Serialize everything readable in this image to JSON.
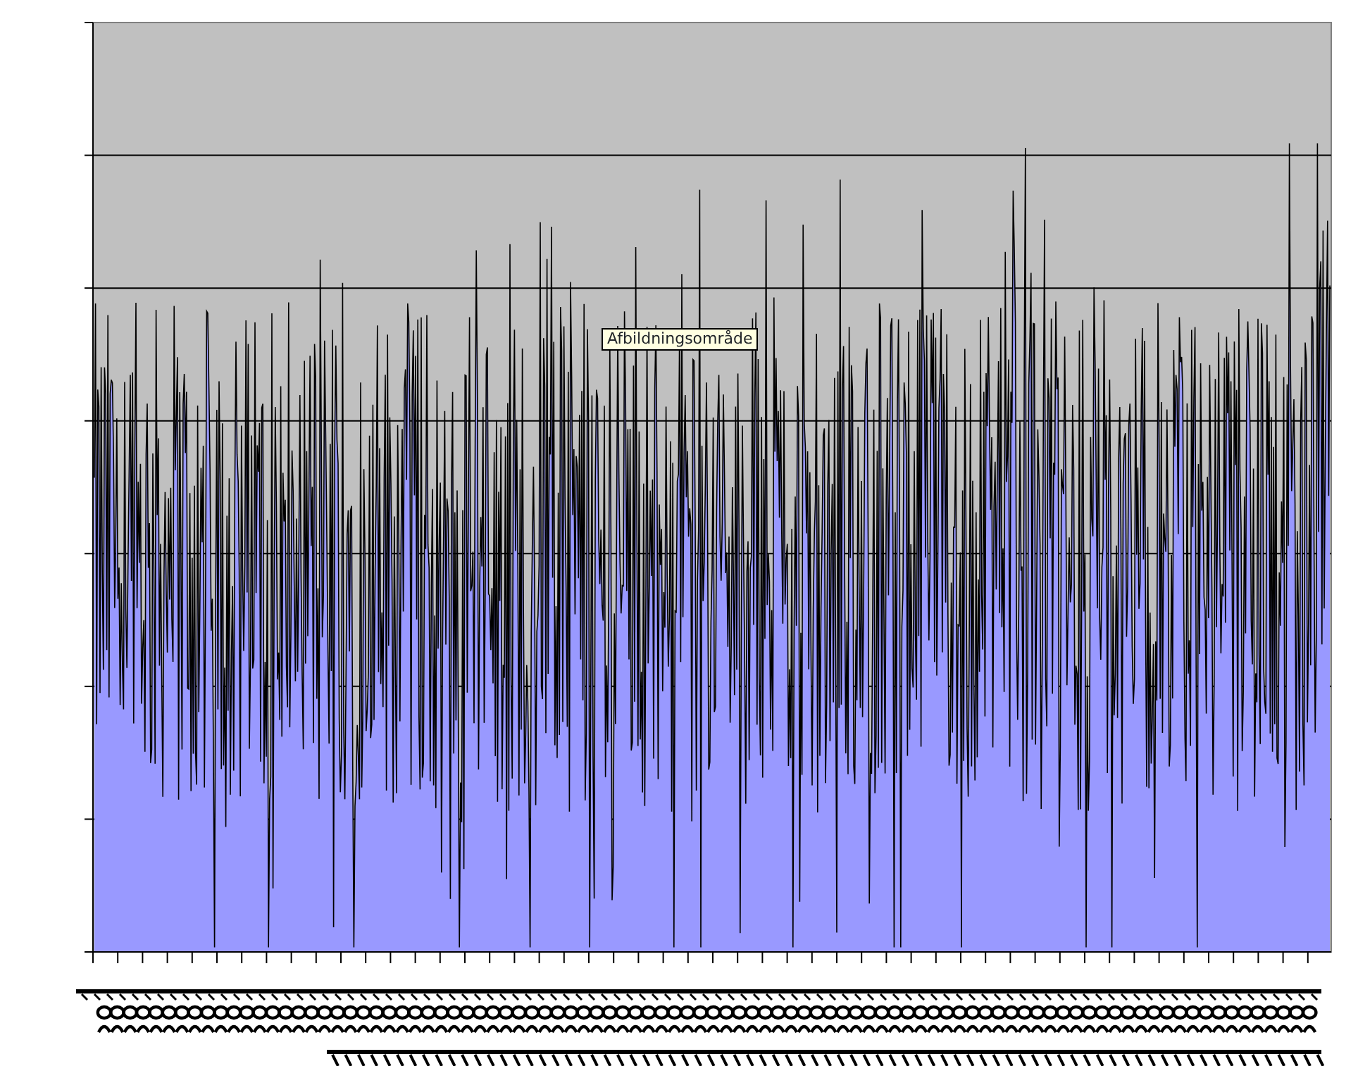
{
  "chart": {
    "tooltip": "Afbildningsområde"
  }
}
